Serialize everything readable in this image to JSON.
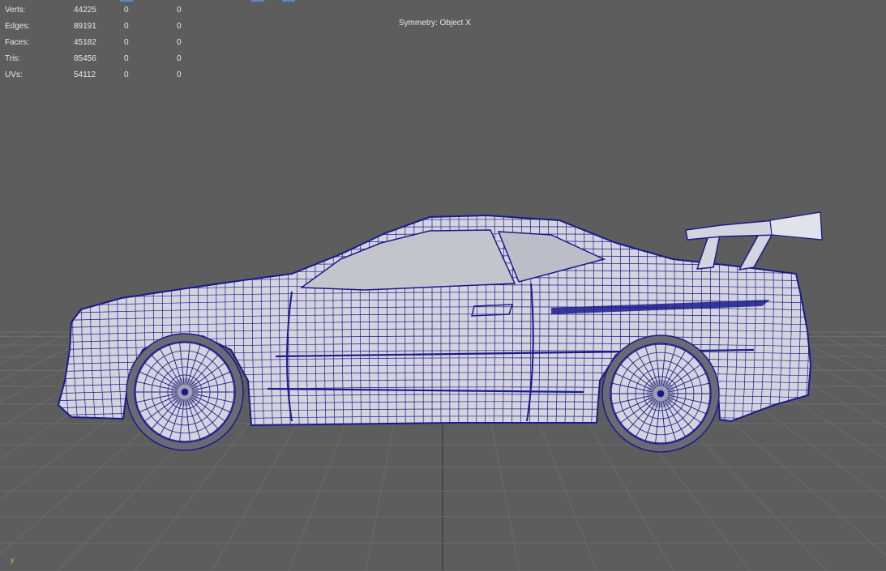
{
  "hud": {
    "rows": [
      {
        "label": "Verts:",
        "total": "44225",
        "selected": "0",
        "shown": "0"
      },
      {
        "label": "Edges:",
        "total": "89191",
        "selected": "0",
        "shown": "0"
      },
      {
        "label": "Faces:",
        "total": "45182",
        "selected": "0",
        "shown": "0"
      },
      {
        "label": "Tris:",
        "total": "85456",
        "selected": "0",
        "shown": "0"
      },
      {
        "label": "UVs:",
        "total": "54112",
        "selected": "0",
        "shown": "0"
      }
    ]
  },
  "symmetry": "Symmetry: Object X",
  "axis": {
    "label": "y"
  },
  "colors": {
    "background": "#5d5d5d",
    "grid": "#6c6c6c",
    "grid_axis": "#3c3c3c",
    "mesh_fill": "#d4d4de",
    "wireframe": "#1a1a8c",
    "text": "#e8e8e8",
    "axis_y": "#9bdc4a"
  }
}
